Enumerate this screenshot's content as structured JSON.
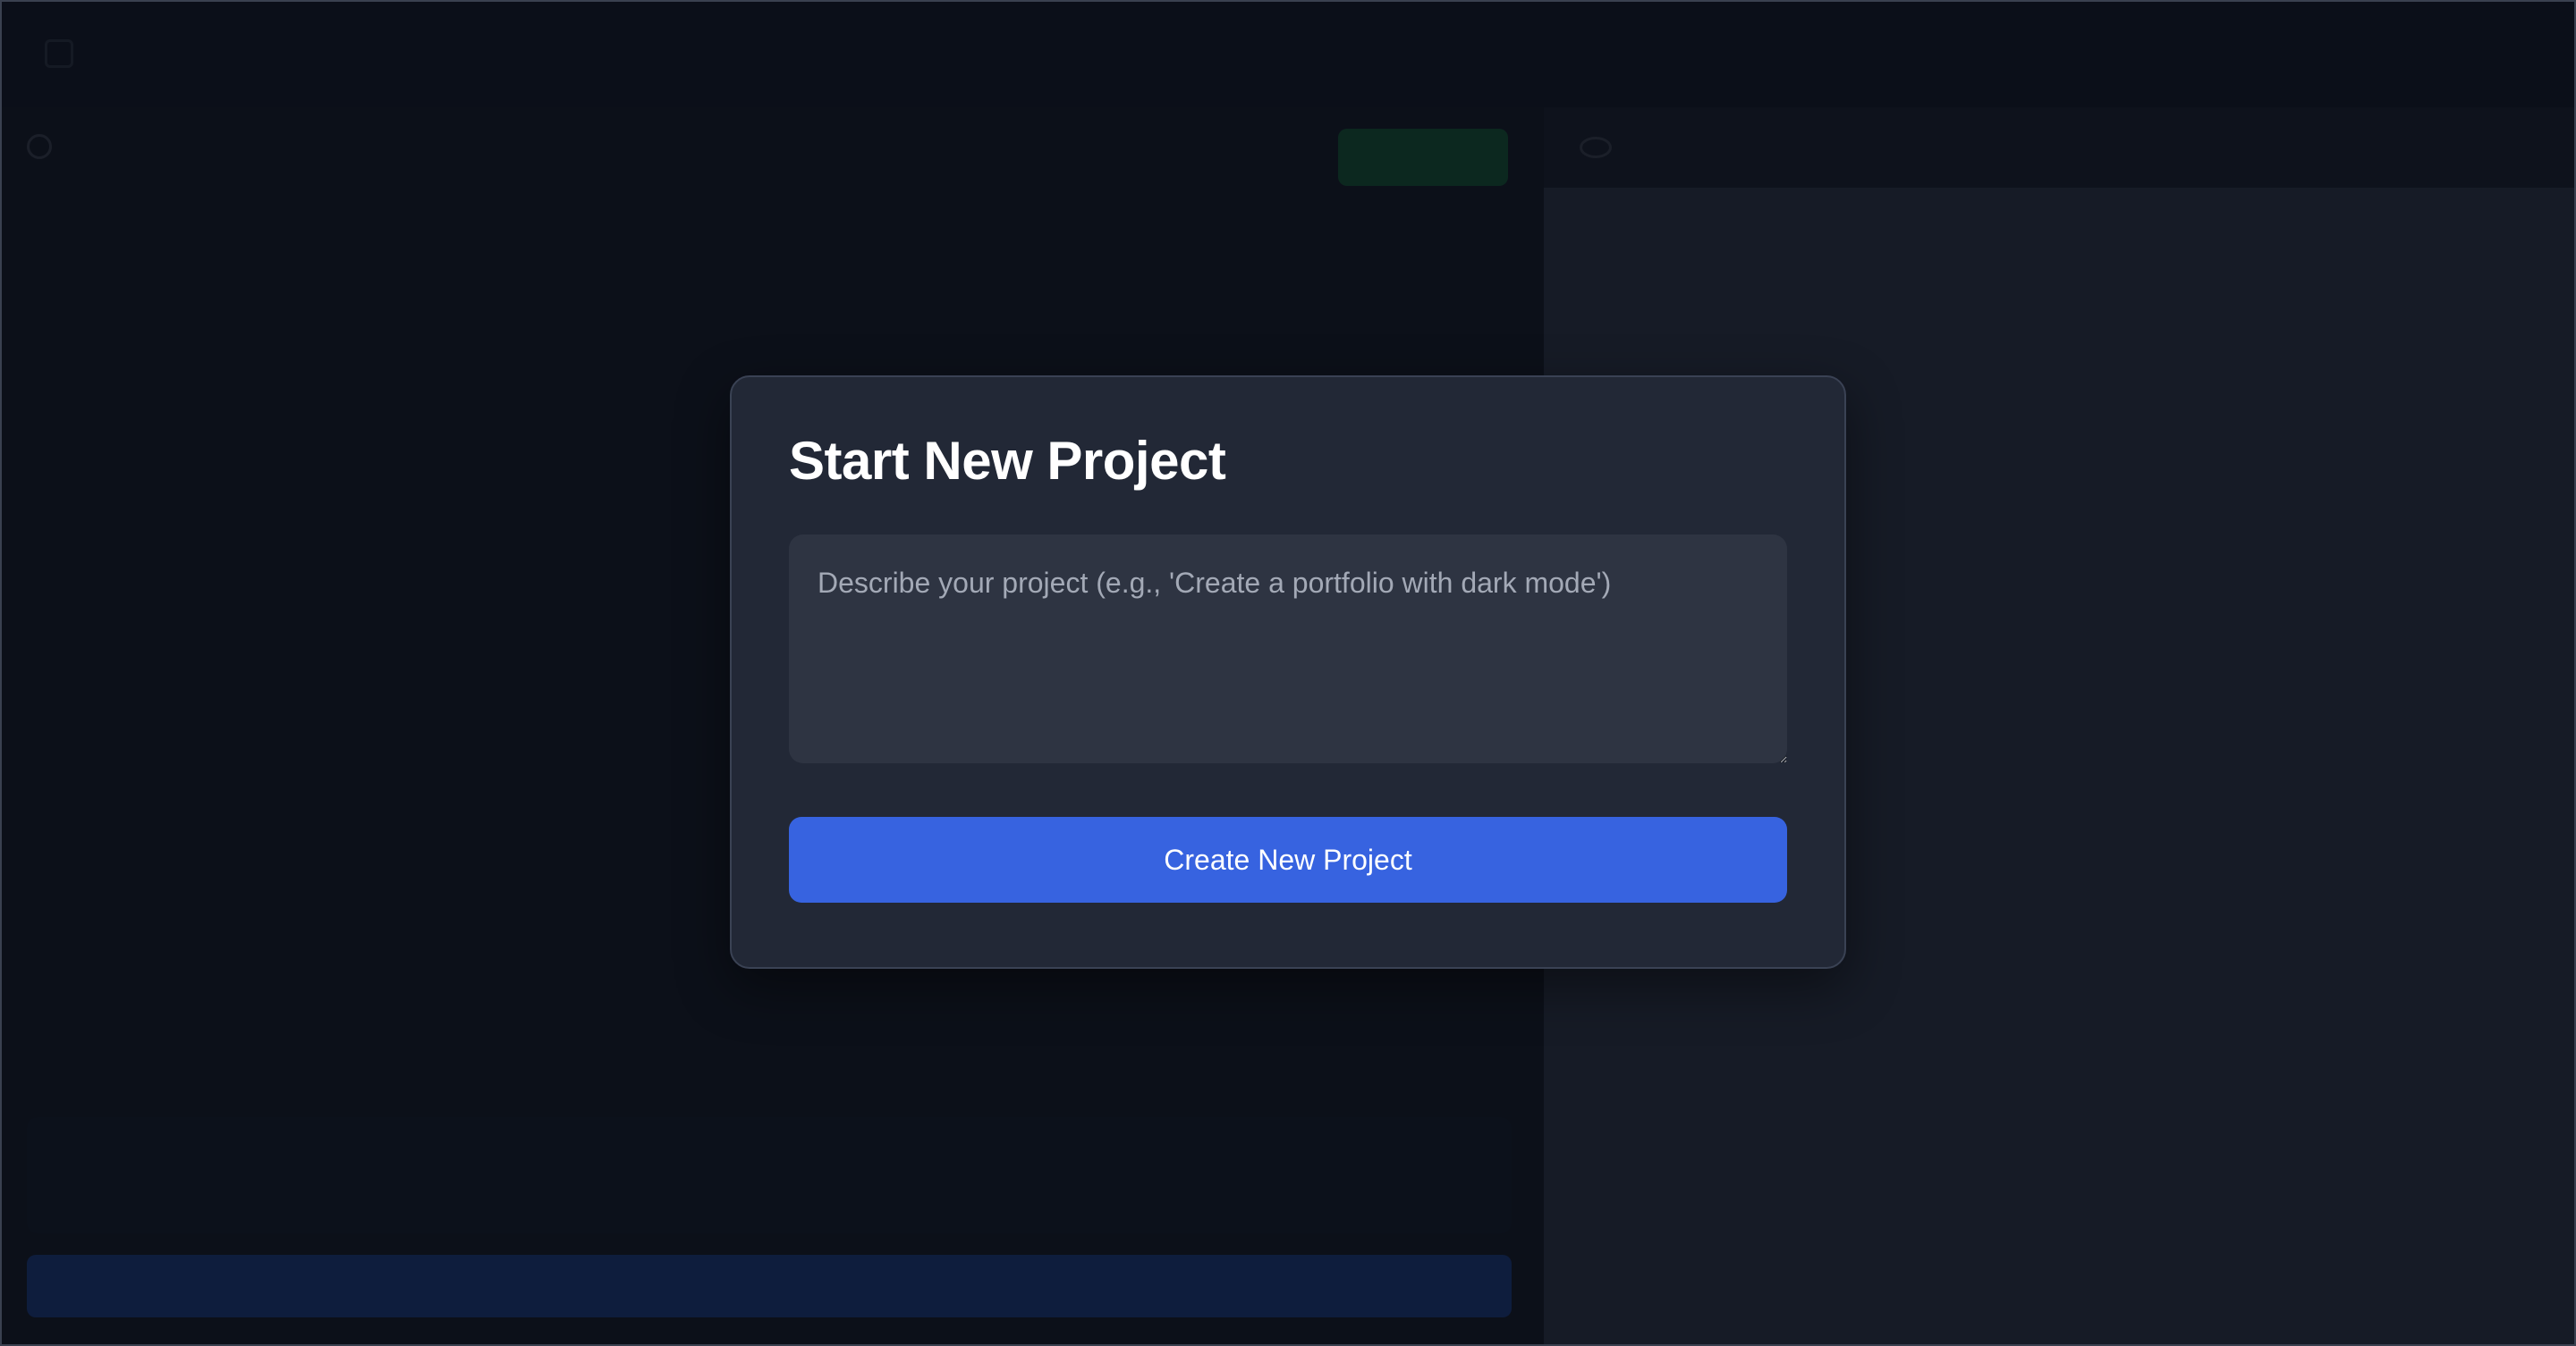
{
  "app": {
    "title": "",
    "subtitle": ""
  },
  "left_panel": {
    "header_label": "",
    "new_button_label": "",
    "file_item": "",
    "chat_placeholder": "",
    "send_button_label": ""
  },
  "right_panel": {
    "header_label": ""
  },
  "modal": {
    "title": "Start New Project",
    "textarea_placeholder": "Describe your project (e.g., 'Create a portfolio with dark mode')",
    "textarea_value": "",
    "button_label": "Create New Project"
  },
  "colors": {
    "background": "#141a28",
    "modal_bg": "#222836",
    "input_bg": "#2e3442",
    "primary_button": "#3763e0",
    "success_button": "#16a34a",
    "preview_bg": "#515a6e"
  }
}
